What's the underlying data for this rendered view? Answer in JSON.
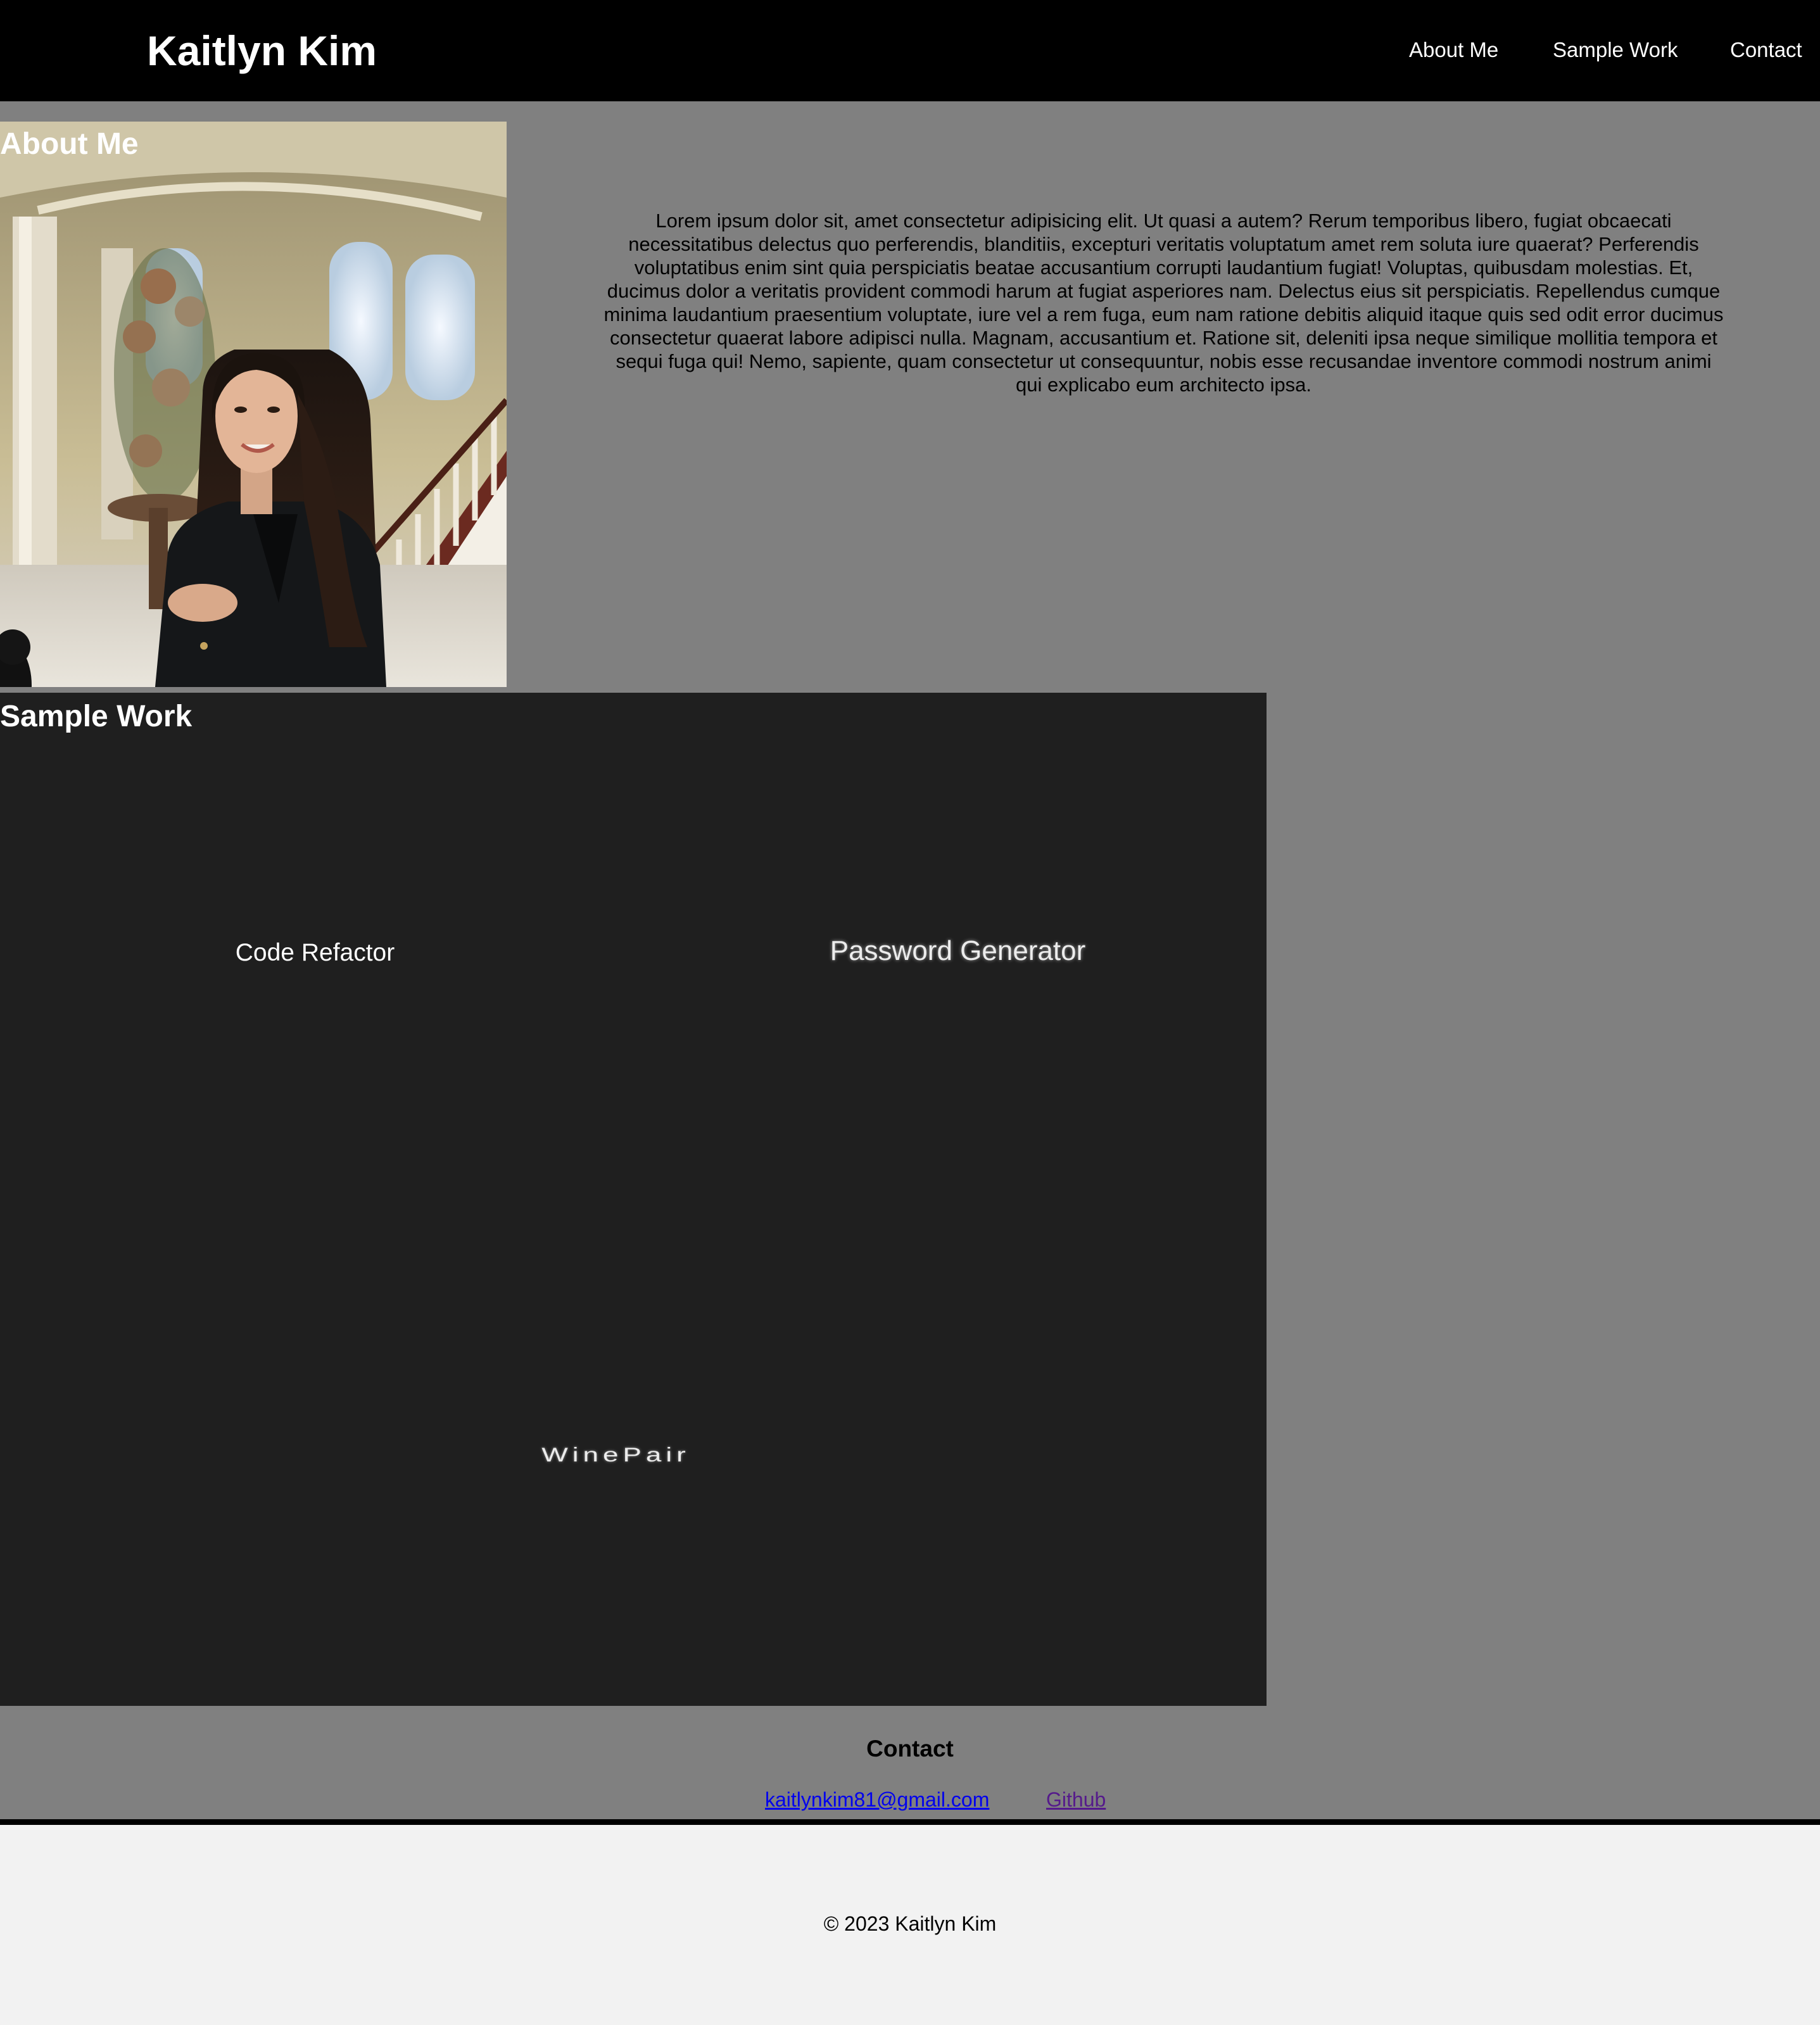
{
  "header": {
    "title": "Kaitlyn Kim",
    "nav": {
      "about": "About Me",
      "work": "Sample Work",
      "contact": "Contact"
    }
  },
  "about": {
    "heading": "About Me",
    "photo_description": "portrait photo",
    "paragraph": "Lorem ipsum dolor sit, amet consectetur adipisicing elit. Ut quasi a autem? Rerum temporibus libero, fugiat obcaecati necessitatibus delectus quo perferendis, blanditiis, excepturi veritatis voluptatum amet rem soluta iure quaerat? Perferendis voluptatibus enim sint quia perspiciatis beatae accusantium corrupti laudantium fugiat! Voluptas, quibusdam molestias. Et, ducimus dolor a veritatis provident commodi harum at fugiat asperiores nam. Delectus eius sit perspiciatis. Repellendus cumque minima laudantium praesentium voluptate, iure vel a rem fuga, eum nam ratione debitis aliquid itaque quis sed odit error ducimus consectetur quaerat labore adipisci nulla. Magnam, accusantium et. Ratione sit, deleniti ipsa neque similique mollitia tempora et sequi fuga qui! Nemo, sapiente, quam consectetur ut consequuntur, nobis esse recusandae inventore commodi nostrum animi qui explicabo eum architecto ipsa."
  },
  "work": {
    "heading": "Sample Work",
    "projects": [
      {
        "label": "Code Refactor"
      },
      {
        "label": "Password Generator"
      },
      {
        "label": "WinePair"
      }
    ]
  },
  "contact": {
    "heading": "Contact",
    "email": "kaitlynkim81@gmail.com",
    "github": "Github"
  },
  "footer": {
    "text": "© 2023 Kaitlyn Kim"
  },
  "colors": {
    "header_bg": "#000000",
    "page_bg": "#808080",
    "work_bg": "#1f1f1f",
    "footer_bg": "#f2f2f2",
    "link": "#0000ee",
    "visited_link": "#551a8b"
  }
}
